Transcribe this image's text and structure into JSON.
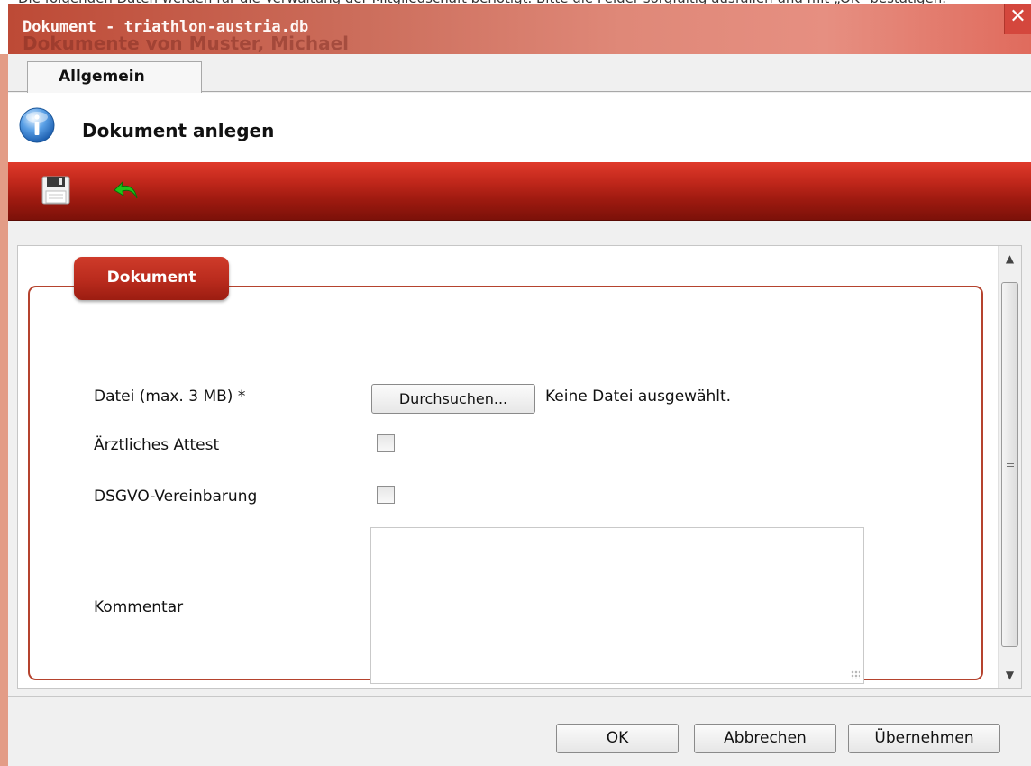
{
  "dialog": {
    "title": "Dokument - triathlon-austria.db",
    "background_title": "Dokumente von Muster, Michael",
    "close_label": "✕"
  },
  "tabs": [
    {
      "label": "Allgemein",
      "active": true
    }
  ],
  "header": {
    "icon": "info-icon",
    "title": "Dokument anlegen"
  },
  "toolbar": {
    "buttons": [
      {
        "name": "save",
        "icon": "floppy-disk-icon"
      },
      {
        "name": "back",
        "icon": "green-back-arrow-icon"
      }
    ]
  },
  "form": {
    "legend": "Dokument",
    "file": {
      "label": "Datei (max. 3 MB) *",
      "button_label": "Durchsuchen...",
      "status": "Keine Datei ausgewählt."
    },
    "attest": {
      "label": "Ärztliches Attest",
      "checked": false
    },
    "dsgvo": {
      "label": "DSGVO-Vereinbarung",
      "checked": false
    },
    "comment": {
      "label": "Kommentar",
      "value": ""
    }
  },
  "footer": {
    "ok_label": "OK",
    "cancel_label": "Abbrechen",
    "apply_label": "Übernehmen"
  },
  "colors": {
    "accent_red": "#b92b1d",
    "toolbar_dark_red": "#7c1109",
    "dialog_bg": "#f0f0f0"
  }
}
